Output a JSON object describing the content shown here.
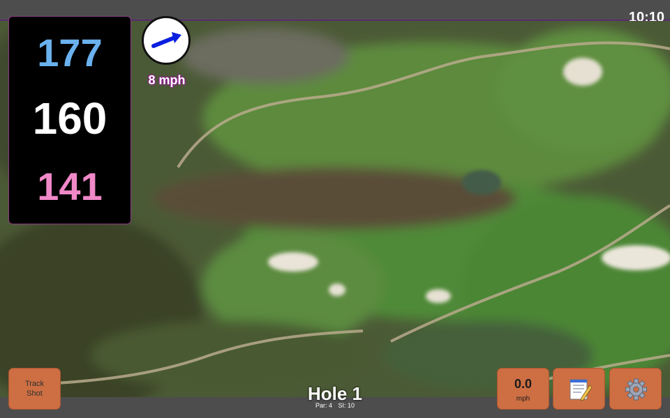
{
  "status_bar": {
    "time": "10:10"
  },
  "distances": {
    "back": "177",
    "middle": "160",
    "front": "141"
  },
  "wind": {
    "speed": "8 mph",
    "direction_icon": "arrow-right-up-icon"
  },
  "buttons": {
    "track_shot_line1": "Track",
    "track_shot_line2": "Shot",
    "speed_value": "0.0",
    "speed_unit": "mph",
    "notes_icon": "notepad-icon",
    "settings_icon": "gear-icon"
  },
  "hole": {
    "title": "Hole 1",
    "par": "Par: 4",
    "si": "SI: 10"
  },
  "colors": {
    "back_distance": "#6ab1ee",
    "middle_distance": "#ffffff",
    "front_distance": "#f088c8",
    "button": "#cd6f43",
    "panel_border": "#8c3b84"
  }
}
